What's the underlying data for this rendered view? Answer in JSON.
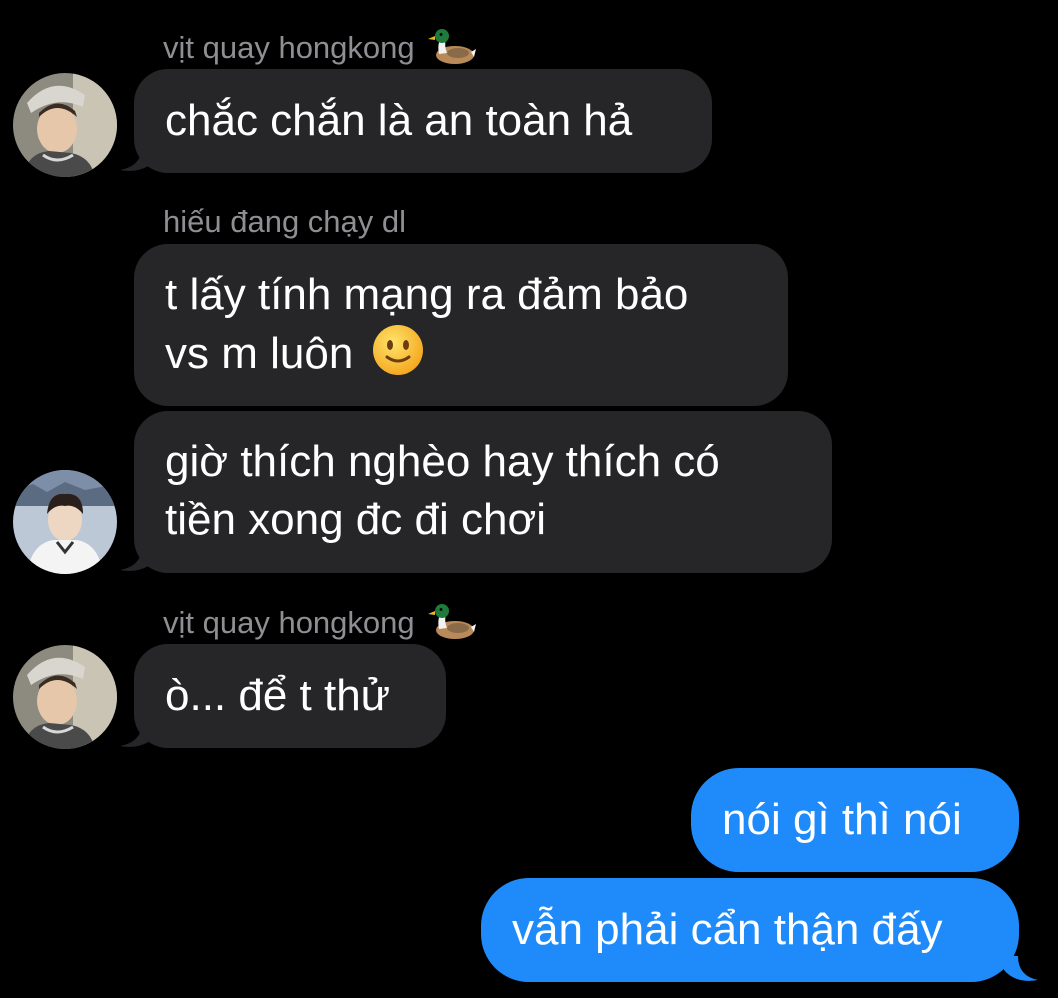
{
  "colors": {
    "background": "#000000",
    "incoming_bubble": "#262629",
    "outgoing_bubble": "#1f8bfb",
    "sender_name": "#8e8e93",
    "text": "#ffffff"
  },
  "messages": [
    {
      "sender": "vịt quay hongkong",
      "sender_icon": "duck-emoji",
      "text": "chắc chắn là an toàn hả",
      "avatar": "avatar-user-1"
    },
    {
      "sender": "hiếu đang chạy dl",
      "line1": "t lấy tính mạng ra đảm bảo",
      "line2": "vs m luôn",
      "trailing_icon": "slightly-smiling-face-emoji"
    },
    {
      "line1": "giờ thích nghèo hay thích có",
      "line2": "tiền xong đc đi chơi",
      "avatar": "avatar-user-2"
    },
    {
      "sender": "vịt quay hongkong",
      "sender_icon": "duck-emoji",
      "text": "ò... để t thử",
      "avatar": "avatar-user-1"
    },
    {
      "text": "nói gì thì nói"
    },
    {
      "text": "vẫn phải cẩn thận đấy"
    }
  ]
}
